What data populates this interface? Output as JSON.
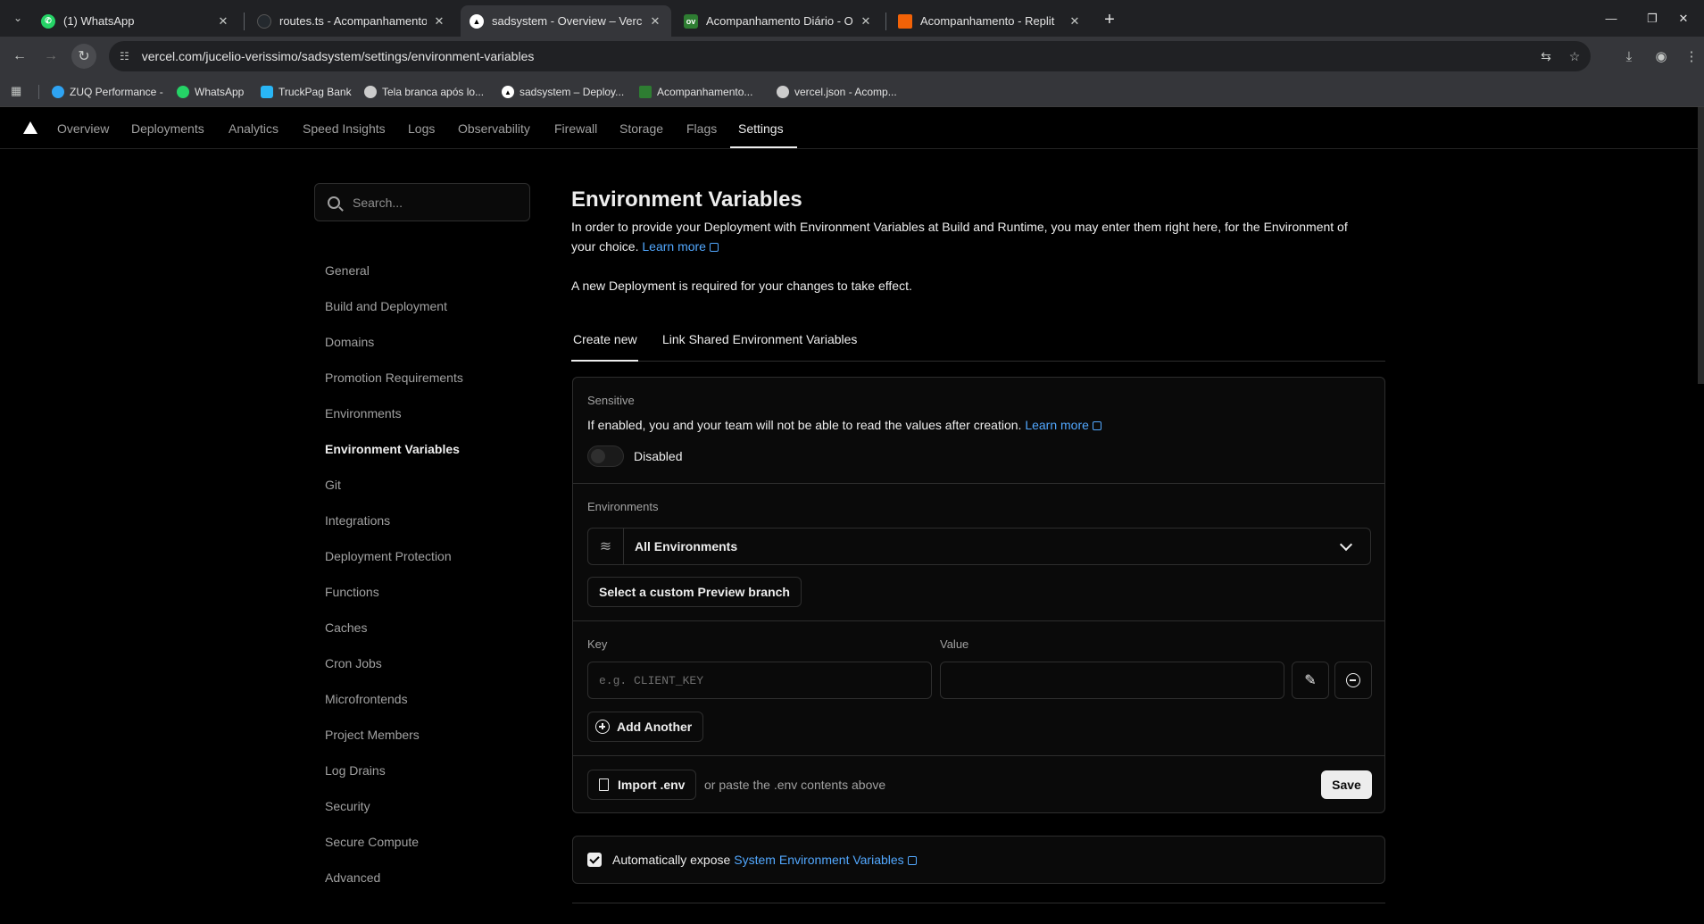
{
  "browser": {
    "tabs": [
      {
        "title": "(1) WhatsApp",
        "favicon_color": "#25d366",
        "favicon_glyph": "✆"
      },
      {
        "title": "routes.ts - Acompanhamento [",
        "favicon_color": "#24292e",
        "favicon_glyph": "●"
      },
      {
        "title": "sadsystem - Overview – Vercel",
        "favicon_color": "#ffffff",
        "favicon_glyph": "▲"
      },
      {
        "title": "Acompanhamento Diário - Our",
        "favicon_color": "#2e7d32",
        "favicon_glyph": "ov"
      },
      {
        "title": "Acompanhamento - Replit",
        "favicon_color": "#f26207",
        "favicon_glyph": "R"
      }
    ],
    "url": "vercel.com/jucelio-verissimo/sadsystem/settings/environment-variables",
    "bookmarks": [
      {
        "label": "ZUQ Performance -",
        "color": "#2ea3f2"
      },
      {
        "label": "WhatsApp",
        "color": "#25d366"
      },
      {
        "label": "TruckPag Bank",
        "color": "#29b6f6"
      },
      {
        "label": "Tela branca após lo...",
        "color": "#cccccc"
      },
      {
        "label": "sadsystem – Deploy...",
        "color": "#ffffff"
      },
      {
        "label": "Acompanhamento...",
        "color": "#2e7d32"
      },
      {
        "label": "vercel.json - Acomp...",
        "color": "#cccccc"
      }
    ]
  },
  "vercel_nav": {
    "items": [
      "Overview",
      "Deployments",
      "Analytics",
      "Speed Insights",
      "Logs",
      "Observability",
      "Firewall",
      "Storage",
      "Flags",
      "Settings"
    ],
    "active": "Settings"
  },
  "sidebar": {
    "search_placeholder": "Search...",
    "items": [
      "General",
      "Build and Deployment",
      "Domains",
      "Promotion Requirements",
      "Environments",
      "Environment Variables",
      "Git",
      "Integrations",
      "Deployment Protection",
      "Functions",
      "Caches",
      "Cron Jobs",
      "Microfrontends",
      "Project Members",
      "Log Drains",
      "Security",
      "Secure Compute",
      "Advanced"
    ],
    "active": "Environment Variables"
  },
  "main": {
    "title": "Environment Variables",
    "intro": "In order to provide your Deployment with Environment Variables at Build and Runtime, you may enter them right here, for the Environment of your choice.",
    "learn_more": "Learn more",
    "notice": "A new Deployment is required for your changes to take effect.",
    "tabs": [
      "Create new",
      "Link Shared Environment Variables"
    ],
    "sensitive": {
      "label": "Sensitive",
      "description": "If enabled, you and your team will not be able to read the values after creation.",
      "learn_more": "Learn more",
      "toggle_state": "Disabled"
    },
    "environments": {
      "label": "Environments",
      "selected": "All Environments",
      "custom_branch_button": "Select a custom Preview branch"
    },
    "key_label": "Key",
    "value_label": "Value",
    "key_placeholder": "e.g. CLIENT_KEY",
    "value_placeholder": "",
    "add_another": "Add Another",
    "import_env": "Import .env",
    "paste_hint": "or paste the .env contents above",
    "save": "Save",
    "auto_expose_prefix": "Automatically expose",
    "auto_expose_link": "System Environment Variables"
  }
}
